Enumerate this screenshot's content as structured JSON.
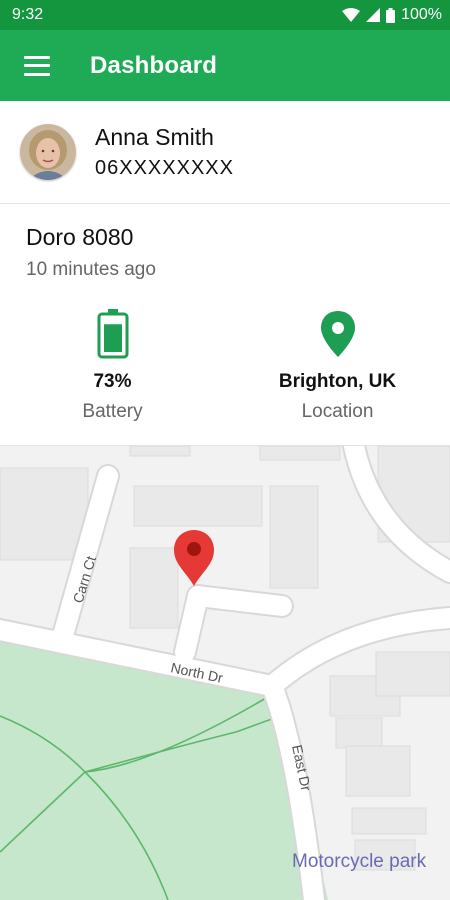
{
  "status_bar": {
    "time": "9:32",
    "battery": "100%"
  },
  "app_bar": {
    "title": "Dashboard"
  },
  "contact": {
    "name": "Anna Smith",
    "phone": "06XXXXXXXX"
  },
  "device": {
    "name": "Doro 8080",
    "last_seen": "10 minutes ago",
    "battery": {
      "value": "73%",
      "label": "Battery",
      "level": 0.73
    },
    "location": {
      "value": "Brighton, UK",
      "label": "Location"
    }
  },
  "map": {
    "streets": {
      "carn_ct": "Carn Ct",
      "north_dr": "North Dr",
      "east_dr": "East Dr"
    },
    "poi": "Motorcycle park"
  },
  "colors": {
    "primary": "#1faa55",
    "status_bar": "#14963f",
    "accent": "#1e9e52",
    "marker": "#e53935"
  }
}
